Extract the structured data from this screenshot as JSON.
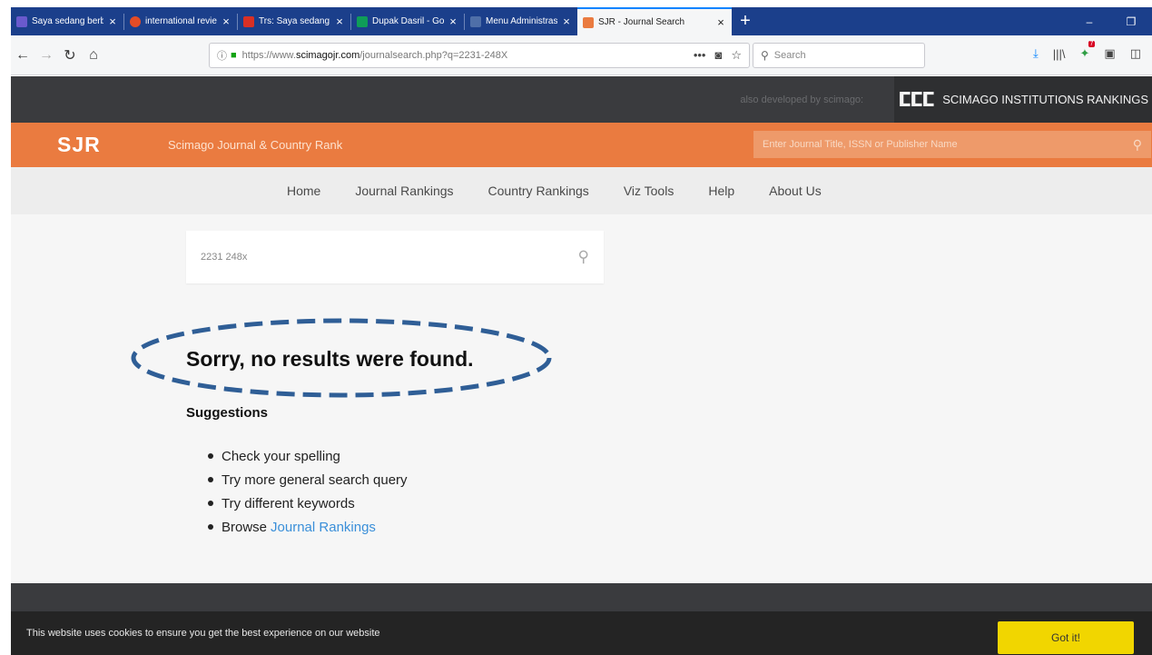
{
  "browser": {
    "tabs": [
      {
        "title": "Saya sedang berbagi",
        "favicon_color": "#6a5acd"
      },
      {
        "title": "international review of",
        "favicon_color": "#e34c26"
      },
      {
        "title": "Trs: Saya sedang berbi",
        "favicon_color": "#d93025"
      },
      {
        "title": "Dupak Dasril - Googl",
        "favicon_color": "#0f9d58"
      },
      {
        "title": "Menu Administrasi Si",
        "favicon_color": "#4f6fa8"
      },
      {
        "title": "SJR - Journal Search",
        "favicon_color": "#ea7b40",
        "active": true
      }
    ],
    "url_host": "scimagojr.com",
    "url_prefix": "https://www.",
    "url_path": "/journalsearch.php?q=2231-248X",
    "search_placeholder": "Search",
    "window_minimize": "–",
    "window_restore": "❐"
  },
  "site": {
    "developed_by": "also developed by scimago:",
    "institutions_label": "SCIMAGO INSTITUTIONS RANKINGS",
    "logo": "SJR",
    "site_name": "Scimago Journal & Country Rank",
    "header_search_placeholder": "Enter Journal Title, ISSN or Publisher Name",
    "menu": [
      "Home",
      "Journal Rankings",
      "Country Rankings",
      "Viz Tools",
      "Help",
      "About Us"
    ]
  },
  "main": {
    "search_value": "2231 248x",
    "no_results": "Sorry, no results were found.",
    "suggestions_title": "Suggestions",
    "suggestions": [
      "Check your spelling",
      "Try more general search query",
      "Try different keywords",
      "Browse"
    ],
    "browse_link": "Journal Rankings",
    "annotation_color": "#2f5e96"
  },
  "cookie": {
    "message": "This website uses cookies to ensure you get the best experience on our website",
    "button": "Got it!"
  },
  "colors": {
    "brand_orange": "#ea7b40",
    "dark_header": "#3a3b3e",
    "cookie_button": "#f1d600",
    "link": "#3a8fd9"
  }
}
